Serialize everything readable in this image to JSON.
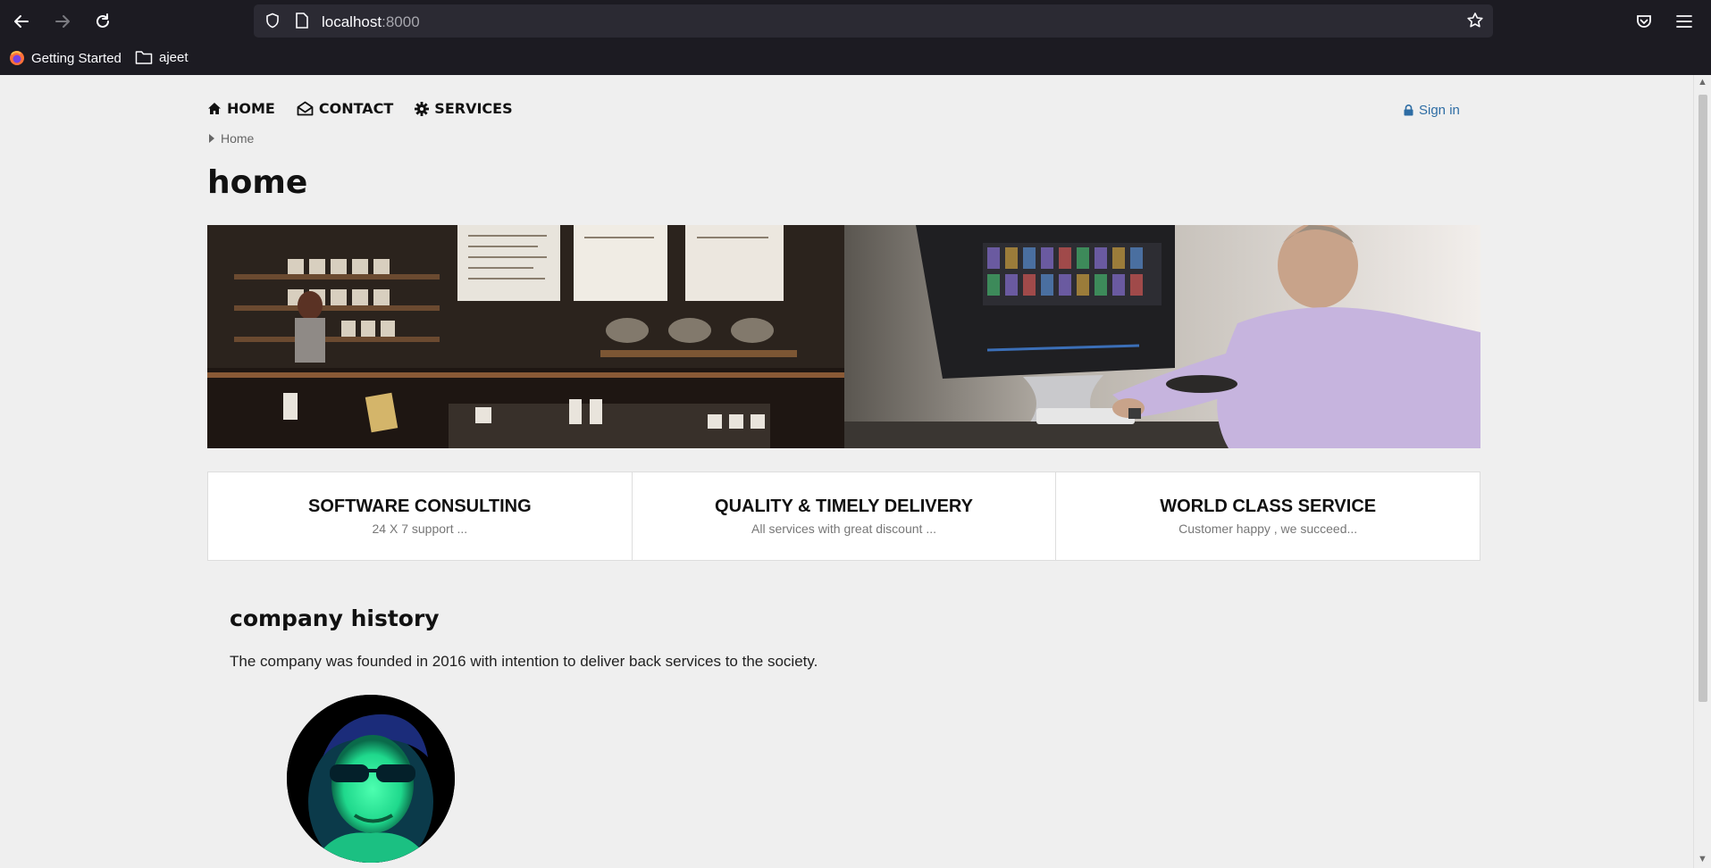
{
  "browser": {
    "url_host": "localhost",
    "url_port": ":8000",
    "bookmarks": [
      {
        "label": "Getting Started"
      },
      {
        "label": "ajeet"
      }
    ]
  },
  "nav": {
    "items": [
      {
        "label": "HOME",
        "icon": "home-icon"
      },
      {
        "label": "CONTACT",
        "icon": "envelope-open-icon"
      },
      {
        "label": "SERVICES",
        "icon": "gear-icon"
      }
    ],
    "signin_label": "Sign in"
  },
  "breadcrumb": {
    "label": "Home"
  },
  "page": {
    "title": "home"
  },
  "features": [
    {
      "title": "SOFTWARE CONSULTING",
      "subtitle": "24 X 7 support ..."
    },
    {
      "title": "QUALITY & TIMELY DELIVERY",
      "subtitle": "All services with great discount ..."
    },
    {
      "title": "WORLD CLASS SERVICE",
      "subtitle": "Customer happy , we succeed..."
    }
  ],
  "history": {
    "title": "company history",
    "text": "The company was founded in 2016 with intention to deliver back services to the society."
  },
  "colors": {
    "link": "#2e6da4",
    "chrome_bg": "#1c1b22",
    "urlbar_bg": "#2b2a33",
    "page_bg": "#efefef"
  }
}
